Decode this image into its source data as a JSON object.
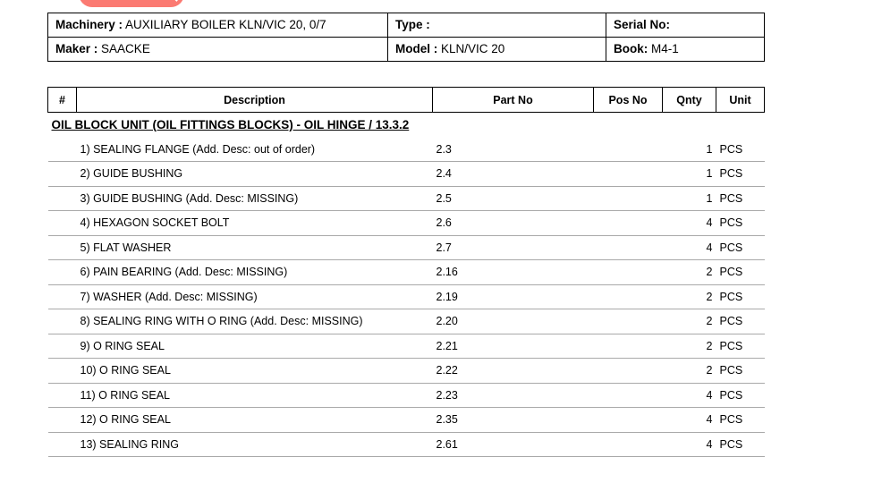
{
  "top_widget": {
    "icon_left": "logo-icon",
    "icon_right": "search-icon",
    "label": "",
    "color": "#fb7a72"
  },
  "info": {
    "rows": [
      [
        {
          "label": "Machinery :",
          "value": "AUXILIARY BOILER KLN/VIC 20, 0/7"
        },
        {
          "label": "Type :",
          "value": ""
        },
        {
          "label": "Serial No:",
          "value": ""
        }
      ],
      [
        {
          "label": "Maker :",
          "value": "SAACKE"
        },
        {
          "label": "Model :",
          "value": "KLN/VIC 20"
        },
        {
          "label": "Book:",
          "value": "M4-1"
        }
      ]
    ]
  },
  "parts_table": {
    "columns": [
      "#",
      "Description",
      "Part No",
      "Pos No",
      "Qnty",
      "Unit"
    ],
    "section_title": "OIL BLOCK UNIT (OIL FITTINGS BLOCKS) - OIL HINGE / 13.3.2",
    "rows": [
      {
        "desc": "1) SEALING FLANGE (Add. Desc: out of order)",
        "part_no": "2.3",
        "pos_no": "",
        "qnty": "1",
        "unit": "PCS"
      },
      {
        "desc": "2) GUIDE BUSHING",
        "part_no": "2.4",
        "pos_no": "",
        "qnty": "1",
        "unit": "PCS"
      },
      {
        "desc": "3) GUIDE BUSHING  (Add. Desc: MISSING)",
        "part_no": "2.5",
        "pos_no": "",
        "qnty": "1",
        "unit": "PCS"
      },
      {
        "desc": "4) HEXAGON SOCKET BOLT",
        "part_no": "2.6",
        "pos_no": "",
        "qnty": "4",
        "unit": "PCS"
      },
      {
        "desc": "5) FLAT WASHER",
        "part_no": "2.7",
        "pos_no": "",
        "qnty": "4",
        "unit": "PCS"
      },
      {
        "desc": "6) PAIN BEARING (Add. Desc: MISSING)",
        "part_no": "2.16",
        "pos_no": "",
        "qnty": "2",
        "unit": "PCS"
      },
      {
        "desc": "7) WASHER (Add. Desc: MISSING)",
        "part_no": "2.19",
        "pos_no": "",
        "qnty": "2",
        "unit": "PCS"
      },
      {
        "desc": "8) SEALING RING WITH O RING (Add. Desc: MISSING)",
        "part_no": "2.20",
        "pos_no": "",
        "qnty": "2",
        "unit": "PCS"
      },
      {
        "desc": "9) O RING SEAL",
        "part_no": "2.21",
        "pos_no": "",
        "qnty": "2",
        "unit": "PCS"
      },
      {
        "desc": "10) O RING SEAL",
        "part_no": "2.22",
        "pos_no": "",
        "qnty": "2",
        "unit": "PCS"
      },
      {
        "desc": "11) O RING SEAL",
        "part_no": "2.23",
        "pos_no": "",
        "qnty": "4",
        "unit": "PCS"
      },
      {
        "desc": "12) O RING SEAL",
        "part_no": "2.35",
        "pos_no": "",
        "qnty": "4",
        "unit": "PCS"
      },
      {
        "desc": "13) SEALING RING",
        "part_no": "2.61",
        "pos_no": "",
        "qnty": "4",
        "unit": "PCS"
      }
    ]
  }
}
